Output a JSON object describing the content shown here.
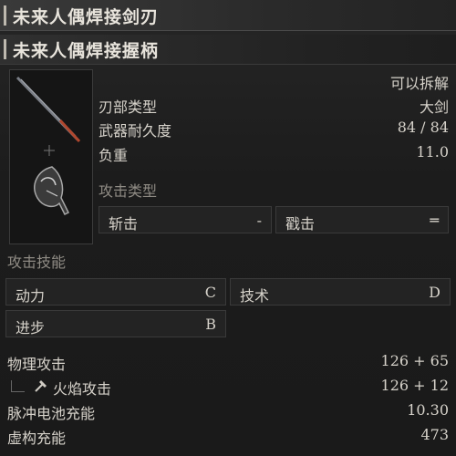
{
  "header": {
    "title": "未来人偶焊接剑刃"
  },
  "subheader": {
    "title": "未来人偶焊接握柄"
  },
  "info": {
    "detachable": "可以拆解",
    "blade_type_label": "刃部类型",
    "blade_type_value": "大剑",
    "durability_label": "武器耐久度",
    "durability_value": "84 / 84",
    "weight_label": "负重",
    "weight_value": "11.0",
    "attack_type_label": "攻击类型"
  },
  "attack_types": [
    {
      "label": "斩击",
      "value": "-"
    },
    {
      "label": "戳击",
      "value": "═"
    }
  ],
  "skills": {
    "section_label": "攻击技能",
    "items": [
      {
        "label": "动力",
        "value": "C"
      },
      {
        "label": "技术",
        "value": "D"
      },
      {
        "label": "进步",
        "value": "B"
      }
    ]
  },
  "stats": {
    "physical_label": "物理攻击",
    "physical_value": "126 + 65",
    "fire_label": "火焰攻击",
    "fire_value": "126 + 12",
    "pulse_label": "脉冲电池充能",
    "pulse_value": "10.30",
    "fable_label": "虚构充能",
    "fable_value": "473"
  },
  "icons": {
    "fire": "fire-hammer-icon"
  },
  "colors": {
    "background": "#1f1f1f",
    "text": "#d8d4cc",
    "muted": "#8f8b84",
    "border": "#3a3a3a"
  }
}
